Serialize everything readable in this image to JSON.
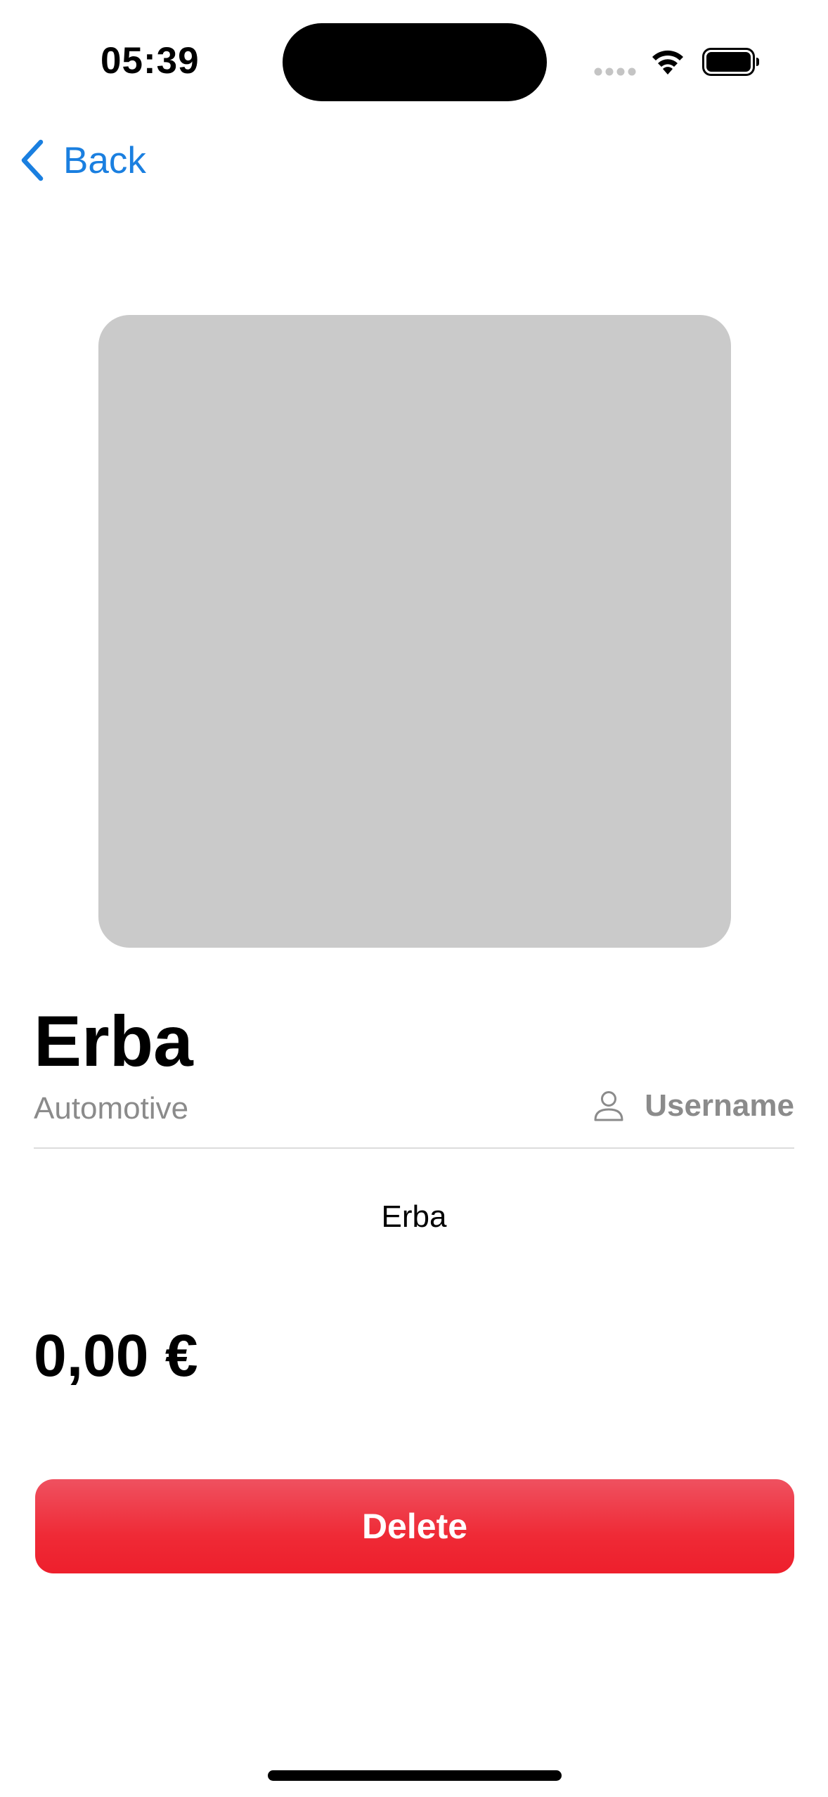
{
  "status_bar": {
    "time": "05:39",
    "icons": [
      "signal-dots-icon",
      "wifi-icon",
      "battery-icon"
    ]
  },
  "nav": {
    "back_label": "Back",
    "back_icon": "chevron-left-icon"
  },
  "product": {
    "image": "product-image-placeholder",
    "title": "Erba",
    "category": "Automotive",
    "seller_icon": "person-icon",
    "seller": "Username",
    "description": "Erba",
    "price": "0,00 €"
  },
  "actions": {
    "delete_label": "Delete"
  },
  "colors": {
    "accent": "#1a7fe0",
    "danger": "#ee2431",
    "image_placeholder": "#cacaca",
    "secondary_text": "#8b8b8b"
  }
}
